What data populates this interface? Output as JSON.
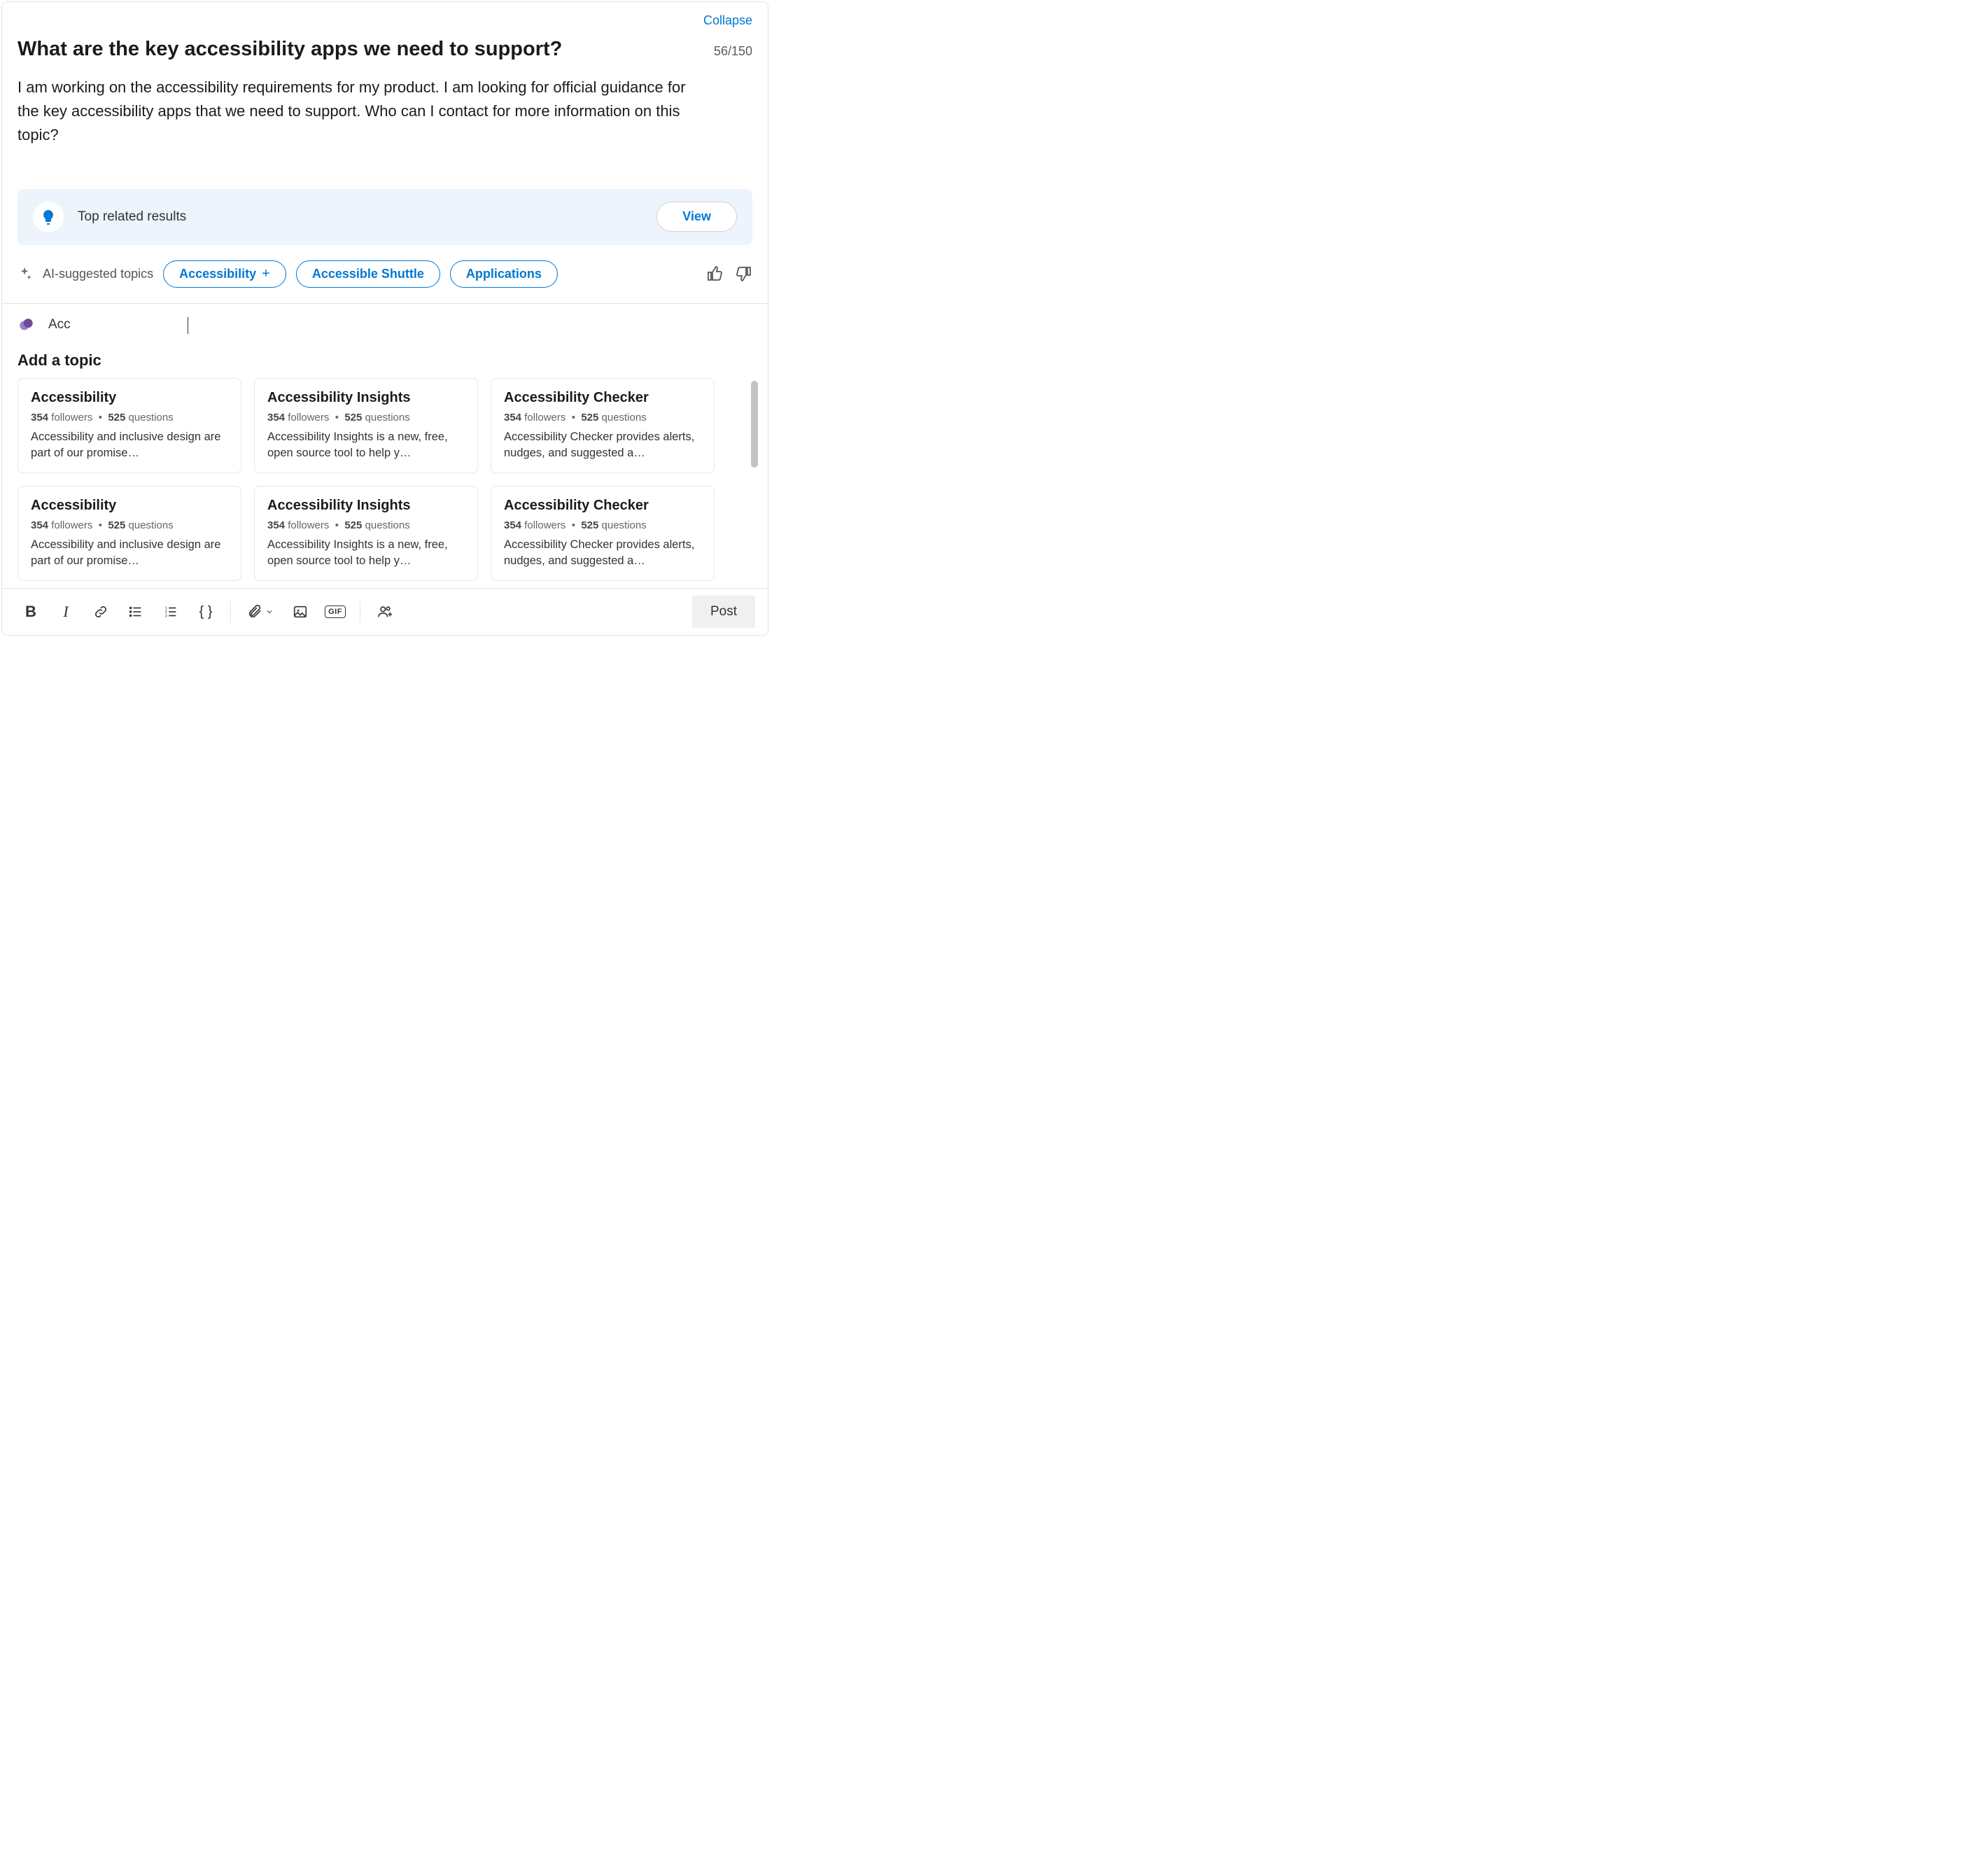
{
  "collapse_label": "Collapse",
  "counter": "56/150",
  "title": "What are the key accessibility apps we need to support?",
  "body": "I am working on the accessibility requirements for my product. I am looking for official guidance for the key accessibility apps that we need to support. Who can I contact for more information on this topic?",
  "related": {
    "label": "Top related results",
    "view_label": "View"
  },
  "ai": {
    "label": "AI-suggested topics",
    "chips": [
      "Accessibility",
      "Accessible Shuttle",
      "Applications"
    ],
    "first_chip_has_plus": true
  },
  "topic_input_value": "Acc",
  "add_topic_heading": "Add a topic",
  "topic_cards": [
    {
      "title": "Accessibility",
      "followers": "354",
      "questions": "525",
      "desc": "Accessibility and inclusive design are part of our promise…"
    },
    {
      "title": "Accessibility Insights",
      "followers": "354",
      "questions": "525",
      "desc": "Accessibility Insights is a new, free, open source tool to help y…"
    },
    {
      "title": "Accessibility Checker",
      "followers": "354",
      "questions": "525",
      "desc": "Accessibility Checker provides alerts, nudges, and suggested a…"
    },
    {
      "title": "Accessibility",
      "followers": "354",
      "questions": "525",
      "desc": "Accessibility and inclusive design are part of our promise…"
    },
    {
      "title": "Accessibility Insights",
      "followers": "354",
      "questions": "525",
      "desc": "Accessibility Insights is a new, free, open source tool to help y…"
    },
    {
      "title": "Accessibility Checker",
      "followers": "354",
      "questions": "525",
      "desc": "Accessibility Checker provides alerts, nudges, and suggested a…"
    }
  ],
  "meta_labels": {
    "followers": "followers",
    "questions": "questions",
    "sep": "•"
  },
  "post_label": "Post",
  "gif_label": "GIF"
}
